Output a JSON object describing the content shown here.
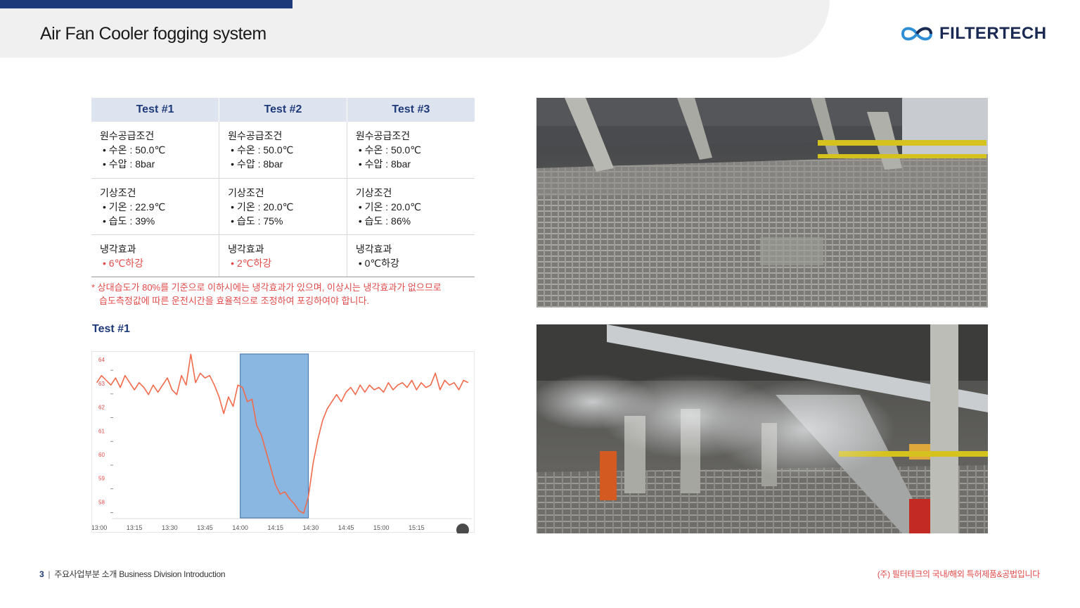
{
  "header": {
    "title": "Air Fan Cooler fogging system",
    "logo_text": "FILTERTECH"
  },
  "table": {
    "headers": [
      "Test #1",
      "Test #2",
      "Test #3"
    ],
    "rows": [
      {
        "label": "원수공급조건",
        "cells": [
          [
            "• 수온 : 50.0℃",
            "• 수압 : 8bar"
          ],
          [
            "• 수온 : 50.0℃",
            "• 수압 : 8bar"
          ],
          [
            "• 수온 : 50.0℃",
            "• 수압 : 8bar"
          ]
        ]
      },
      {
        "label": "기상조건",
        "cells": [
          [
            "• 기온 : 22.9℃",
            "• 습도 : 39%"
          ],
          [
            "• 기온 : 20.0℃",
            "• 습도 : 75%"
          ],
          [
            "• 기온 : 20.0℃",
            "• 습도 : 86%"
          ]
        ]
      },
      {
        "label": "냉각효과",
        "cells": [
          [
            "• 6℃하강"
          ],
          [
            "• 2℃하강"
          ],
          [
            "• 0℃하강"
          ]
        ]
      }
    ]
  },
  "note": {
    "line1": "* 상대습도가 80%를 기준으로 이하시에는 냉각효과가 있으며, 이상시는 냉각효과가 없으므로",
    "line2": "습도측정값에 따른 운전시간을 효율적으로 조정하여 포깅하여야 합니다."
  },
  "chart": {
    "section_title": "Test #1"
  },
  "chart_data": {
    "type": "line",
    "title": "",
    "xlabel": "",
    "ylabel": "",
    "x_ticks": [
      "13:00",
      "13:15",
      "13:30",
      "13:45",
      "14:00",
      "14:15",
      "14:30",
      "14:45",
      "15:00",
      "15:15"
    ],
    "y_ticks": [
      64,
      63,
      62,
      61,
      60,
      59,
      58
    ],
    "ylim": [
      57.3,
      64.3
    ],
    "xlim_minutes_from_13_00": [
      -3,
      160
    ],
    "highlight_range": [
      "14:00",
      "14:29"
    ],
    "series": [
      {
        "color": "#f26a4b",
        "x": [
          "12:59",
          "13:01",
          "13:03",
          "13:05",
          "13:07",
          "13:09",
          "13:11",
          "13:13",
          "13:15",
          "13:17",
          "13:19",
          "13:21",
          "13:23",
          "13:25",
          "13:27",
          "13:29",
          "13:31",
          "13:33",
          "13:35",
          "13:37",
          "13:39",
          "13:41",
          "13:43",
          "13:45",
          "13:47",
          "13:49",
          "13:51",
          "13:53",
          "13:55",
          "13:57",
          "13:59",
          "14:01",
          "14:03",
          "14:05",
          "14:07",
          "14:09",
          "14:11",
          "14:13",
          "14:15",
          "14:17",
          "14:19",
          "14:21",
          "14:23",
          "14:25",
          "14:27",
          "14:29",
          "14:31",
          "14:33",
          "14:35",
          "14:37",
          "14:39",
          "14:41",
          "14:43",
          "14:45",
          "14:47",
          "14:49",
          "14:51",
          "14:53",
          "14:55",
          "14:57",
          "14:59",
          "15:01",
          "15:03",
          "15:05",
          "15:07",
          "15:09",
          "15:11",
          "15:13",
          "15:15",
          "15:17",
          "15:19",
          "15:21",
          "15:23",
          "15:25",
          "15:27",
          "15:29",
          "15:31",
          "15:33",
          "15:35",
          "15:37"
        ],
        "values": [
          63.0,
          63.3,
          63.1,
          62.9,
          63.2,
          62.8,
          63.3,
          63.0,
          62.7,
          63.0,
          62.8,
          62.5,
          62.9,
          62.6,
          62.9,
          63.2,
          62.7,
          62.5,
          63.3,
          62.9,
          64.2,
          63.0,
          63.4,
          63.2,
          63.3,
          62.9,
          62.4,
          61.7,
          62.4,
          62.0,
          62.9,
          62.8,
          62.2,
          62.3,
          61.2,
          60.8,
          60.1,
          59.4,
          58.7,
          58.3,
          58.4,
          58.1,
          57.9,
          57.6,
          57.5,
          58.2,
          59.6,
          60.6,
          61.4,
          61.9,
          62.2,
          62.5,
          62.2,
          62.6,
          62.8,
          62.5,
          62.9,
          62.6,
          62.9,
          62.7,
          62.8,
          62.6,
          63.0,
          62.7,
          62.9,
          63.0,
          62.8,
          63.1,
          62.7,
          63.0,
          62.8,
          62.9,
          63.4,
          62.7,
          63.1,
          62.9,
          63.0,
          62.7,
          63.1,
          63.0
        ]
      }
    ]
  },
  "footer": {
    "page_number": "3",
    "separator": "|",
    "section": "주요사업부분 소개 Business Division Introduction",
    "right_text": "(주) 필터테크의 국내/해외 특허제품&공법입니다"
  },
  "photos": {
    "top_alt_icon": "photo-grating-floor",
    "bottom_alt_icon": "photo-fogging-structure"
  },
  "colors": {
    "brand_navy": "#1e3a78",
    "accent_red": "#e24a4a",
    "line_orange": "#f26a4b",
    "highlight_blue": "#5b9bd5",
    "table_header_bg": "#dde3ef"
  }
}
